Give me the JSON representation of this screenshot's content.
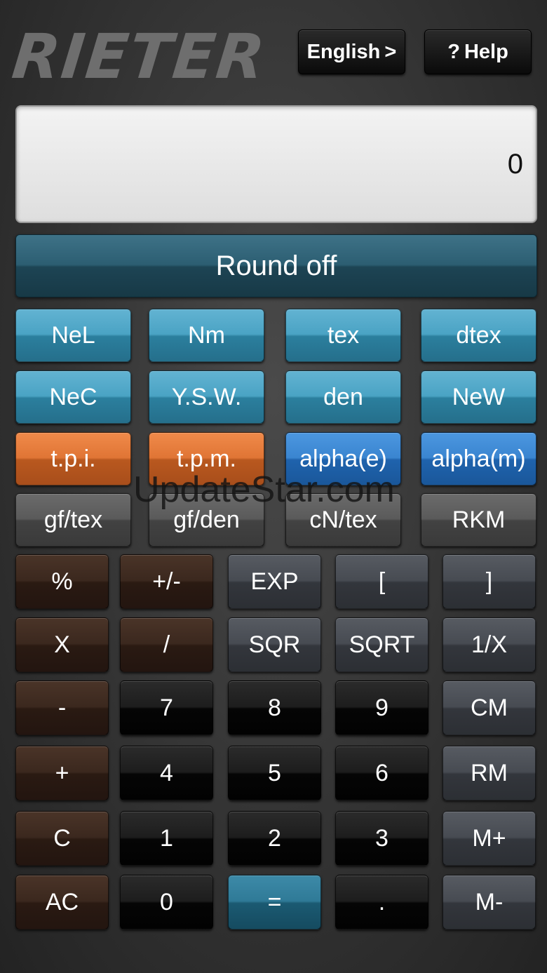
{
  "header": {
    "logo": "RIETER",
    "language_label": "English",
    "language_chevron": ">",
    "help_icon": "?",
    "help_label": "Help"
  },
  "display": {
    "value": "0"
  },
  "round_off_label": "Round off",
  "unit_rows": [
    [
      "NeL",
      "Nm",
      "tex",
      "dtex"
    ],
    [
      "NeC",
      "Y.S.W.",
      "den",
      "NeW"
    ],
    [
      "t.p.i.",
      "t.p.m.",
      "alpha(e)",
      "alpha(m)"
    ],
    [
      "gf/tex",
      "gf/den",
      "cN/tex",
      "RKM"
    ]
  ],
  "keypad_rows": [
    [
      "%",
      "+/-",
      "EXP",
      "[",
      "]"
    ],
    [
      "X",
      "/",
      "SQR",
      "SQRT",
      "1/X"
    ],
    [
      "-",
      "7",
      "8",
      "9",
      "CM"
    ],
    [
      "+",
      "4",
      "5",
      "6",
      "RM"
    ],
    [
      "C",
      "1",
      "2",
      "3",
      "M+"
    ],
    [
      "AC",
      "0",
      "=",
      ".",
      "M-"
    ]
  ],
  "watermark": "UpdateStar.com",
  "colors": {
    "unit_teal": "#4aa3c4",
    "twist_orange": "#e07535",
    "alpha_blue": "#3a85d0",
    "strength_gray": "#5a5a5a",
    "operator_brown": "#3b281e",
    "function_gray": "#474b52",
    "digit_black": "#1d1d1d",
    "equals_teal": "#2f7a97"
  }
}
